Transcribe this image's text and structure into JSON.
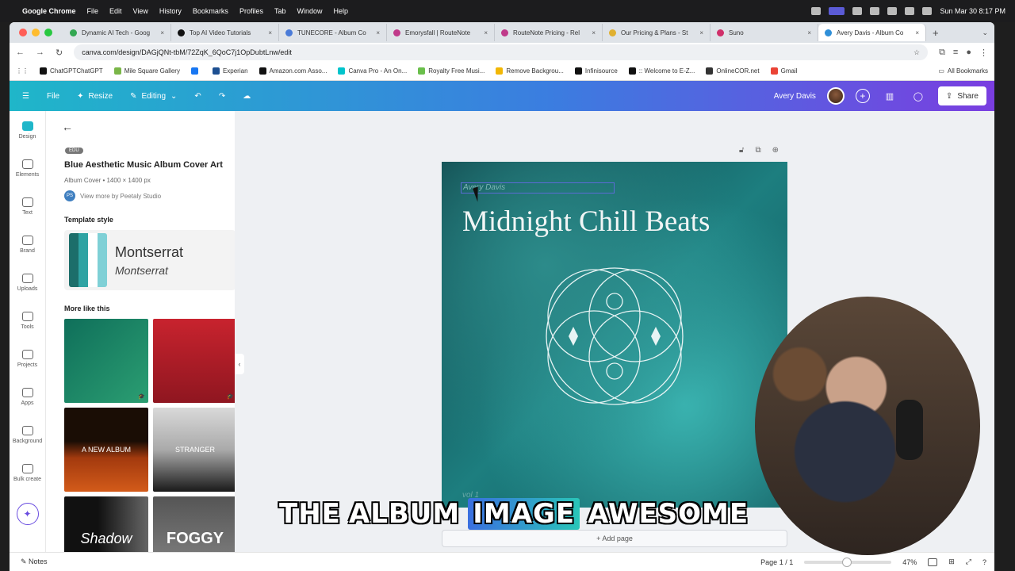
{
  "menubar": {
    "app": "Google Chrome",
    "items": [
      "File",
      "Edit",
      "View",
      "History",
      "Bookmarks",
      "Profiles",
      "Tab",
      "Window",
      "Help"
    ],
    "clock": "Sun Mar 30  8:17 PM"
  },
  "tabs": [
    {
      "label": "Dynamic AI Tech - Goog",
      "color": "#34a853"
    },
    {
      "label": "Top AI Video Tutorials",
      "color": "#111111"
    },
    {
      "label": "TUNECORE - Album Co",
      "color": "#4a7bd8"
    },
    {
      "label": "Emorysfall | RouteNote",
      "color": "#c03a8a"
    },
    {
      "label": "RouteNote Pricing - Rel",
      "color": "#c03a8a"
    },
    {
      "label": "Our Pricing & Plans - St",
      "color": "#e0b030"
    },
    {
      "label": "Suno",
      "color": "#d0306a"
    },
    {
      "label": "Avery Davis - Album Co",
      "color": "#2f8fd8"
    }
  ],
  "address": {
    "url": "canva.com/design/DAGjQNt-tbM/72ZqK_6QoC7j1OpDubtLnw/edit"
  },
  "bookmarks": [
    {
      "label": "ChatGPTChatGPT",
      "color": "#111111"
    },
    {
      "label": "Mile Square Gallery",
      "color": "#7ab648"
    },
    {
      "label": "",
      "color": "#1877f2"
    },
    {
      "label": "Experian",
      "color": "#1d4f91"
    },
    {
      "label": "Amazon.com Asso...",
      "color": "#111111"
    },
    {
      "label": "Canva Pro - An On...",
      "color": "#00c4cc"
    },
    {
      "label": "Royalty Free Musi...",
      "color": "#6abf4b"
    },
    {
      "label": "Remove Backgrou...",
      "color": "#f2b705"
    },
    {
      "label": "Infinisource",
      "color": "#111111"
    },
    {
      "label": ":: Welcome to E-Z...",
      "color": "#111111"
    },
    {
      "label": "OnlineCOR.net",
      "color": "#333333"
    },
    {
      "label": "Gmail",
      "color": "#ea4335"
    }
  ],
  "bookmarks_all": "All Bookmarks",
  "header": {
    "file": "File",
    "resize": "Resize",
    "editing": "Editing",
    "user": "Avery Davis",
    "share": "Share"
  },
  "rail": [
    "Design",
    "Elements",
    "Text",
    "Brand",
    "Uploads",
    "Tools",
    "Projects",
    "Apps",
    "Background",
    "Bulk create"
  ],
  "panel": {
    "badge": "EDU",
    "title": "Blue Aesthetic Music Album Cover Art",
    "subtitle": "Album Cover • 1400 × 1400 px",
    "creator_initials": "PS",
    "creator": "View more by Peetaly Studio",
    "template_style": "Template style",
    "font_primary": "Montserrat",
    "font_secondary": "Montserrat",
    "more_like_this": "More like this",
    "swatches": [
      "#1c6e6a",
      "#2fa3a3",
      "#ffffff",
      "#7fd0d6"
    ],
    "thumb_texts": [
      "",
      "",
      "A NEW ALBUM",
      "STRANGER",
      "Shadow",
      "FOGGY"
    ]
  },
  "cover": {
    "artist": "Avery Davis",
    "title": "Midnight Chill Beats",
    "vol": "vol 1"
  },
  "add_page": "+ Add page",
  "caption": [
    "THE",
    "ALBUM",
    "IMAGE",
    "AWESOME"
  ],
  "status": {
    "notes": "Notes",
    "page": "Page 1 / 1",
    "zoom": "47%",
    "zoom_level": 0.47
  }
}
